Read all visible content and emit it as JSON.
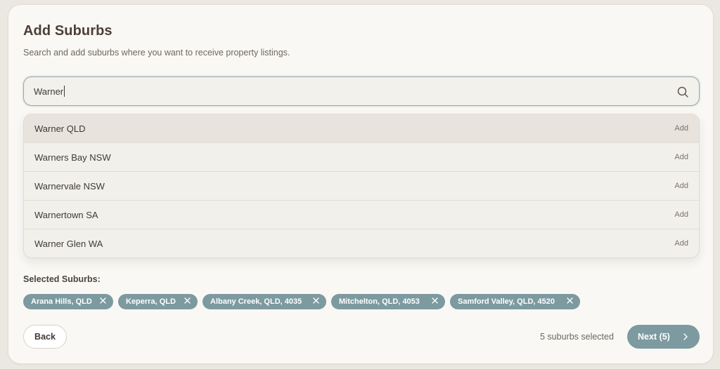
{
  "header": {
    "title": "Add Suburbs",
    "subtitle": "Search and add suburbs where you want to receive property listings."
  },
  "search": {
    "value": "Warner",
    "icon": "search-icon"
  },
  "suggestions": [
    {
      "label": "Warner QLD",
      "action": "Add",
      "highlighted": true
    },
    {
      "label": "Warners Bay NSW",
      "action": "Add",
      "highlighted": false
    },
    {
      "label": "Warnervale NSW",
      "action": "Add",
      "highlighted": false
    },
    {
      "label": "Warnertown SA",
      "action": "Add",
      "highlighted": false
    },
    {
      "label": "Warner Glen WA",
      "action": "Add",
      "highlighted": false
    }
  ],
  "selected": {
    "label": "Selected Suburbs:",
    "chips": [
      {
        "label": "Arana Hills, QLD"
      },
      {
        "label": "Keperra, QLD"
      },
      {
        "label": "Albany Creek, QLD, 4035"
      },
      {
        "label": "Mitchelton, QLD, 4053"
      },
      {
        "label": "Samford Valley, QLD, 4520"
      }
    ]
  },
  "footer": {
    "back_label": "Back",
    "count_text": "5 suburbs selected",
    "next_label": "Next (5)"
  },
  "colors": {
    "accent": "#7c9aa0",
    "background": "#faf8f4",
    "title": "#4b3f38"
  }
}
